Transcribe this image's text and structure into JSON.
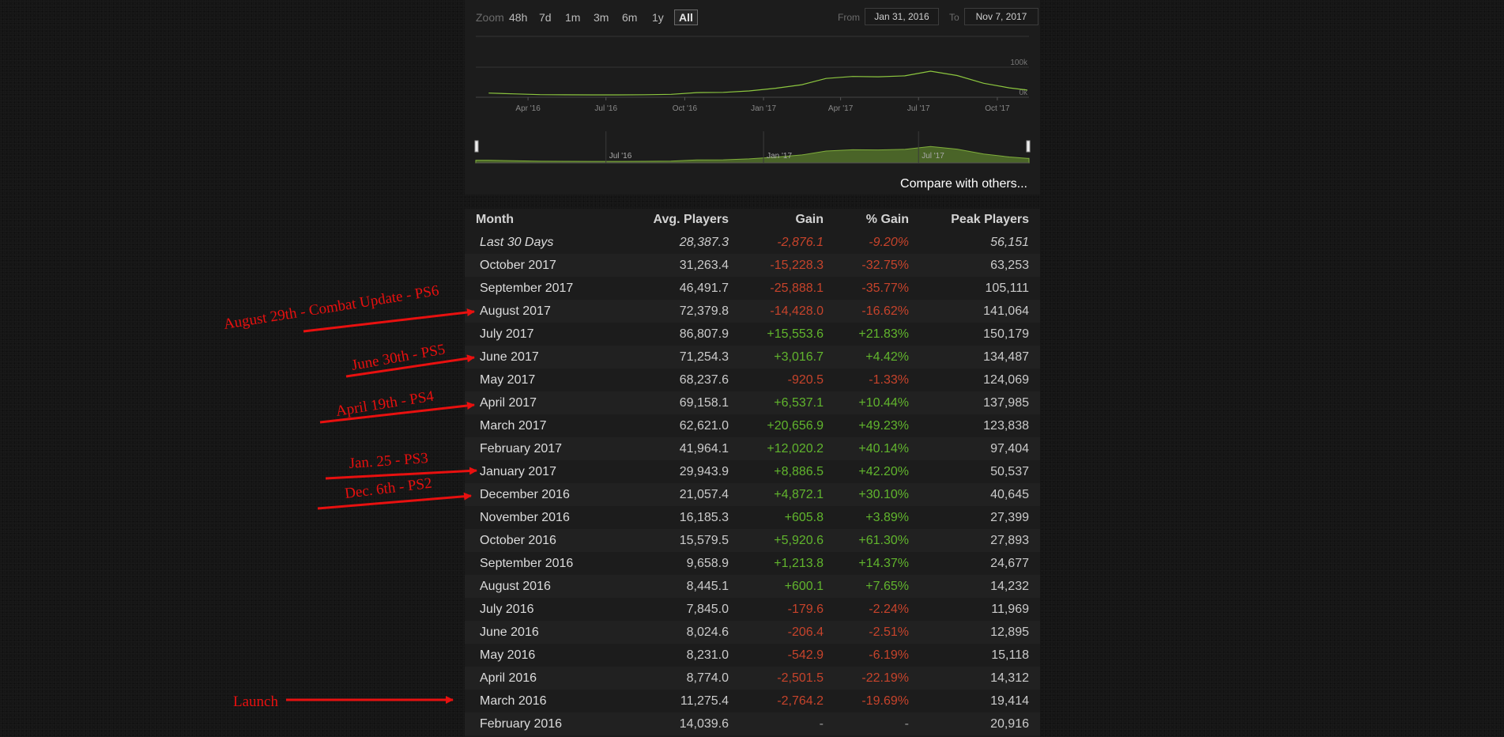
{
  "zoom": {
    "label": "Zoom",
    "options": [
      "48h",
      "7d",
      "1m",
      "3m",
      "6m",
      "1y",
      "All"
    ],
    "active": "All"
  },
  "range": {
    "from_label": "From",
    "from_value": "Jan 31, 2016",
    "to_label": "To",
    "to_value": "Nov 7, 2017"
  },
  "compare_link": "Compare with others...",
  "chart_data": {
    "type": "line",
    "x_ticks": [
      "Apr '16",
      "Jul '16",
      "Oct '16",
      "Jan '17",
      "Apr '17",
      "Jul '17",
      "Oct '17"
    ],
    "y_ticks": [
      "100k",
      "0k"
    ],
    "navigator_ticks": [
      "Jul '16",
      "Jan '17",
      "Jul '17"
    ],
    "x_range": [
      "2016-01-31",
      "2017-11-07"
    ],
    "ylim": [
      0,
      150000
    ],
    "series": [
      {
        "x": [
          "2016-02-15",
          "2016-03-15",
          "2016-04-15",
          "2016-05-15",
          "2016-06-15",
          "2016-07-15",
          "2016-08-15",
          "2016-09-15",
          "2016-10-15",
          "2016-11-15",
          "2016-12-15",
          "2017-01-15",
          "2017-02-15",
          "2017-03-15",
          "2017-04-15",
          "2017-05-15",
          "2017-06-15",
          "2017-07-15",
          "2017-08-15",
          "2017-09-15",
          "2017-10-15",
          "2017-11-05"
        ],
        "values": [
          14040,
          11275,
          8774,
          8231,
          8025,
          7845,
          8445,
          9659,
          15580,
          16185,
          21057,
          29944,
          41964,
          62621,
          69158,
          68238,
          71254,
          86808,
          72380,
          46492,
          31263,
          24000
        ]
      }
    ],
    "color": "#8cc63f"
  },
  "table": {
    "headers": [
      "Month",
      "Avg. Players",
      "Gain",
      "% Gain",
      "Peak Players"
    ],
    "rows": [
      {
        "month": "Last 30 Days",
        "avg": "28,387.3",
        "gain": "-2,876.1",
        "pct": "-9.20%",
        "peak": "56,151",
        "trend": "neg"
      },
      {
        "month": "October 2017",
        "avg": "31,263.4",
        "gain": "-15,228.3",
        "pct": "-32.75%",
        "peak": "63,253",
        "trend": "neg"
      },
      {
        "month": "September 2017",
        "avg": "46,491.7",
        "gain": "-25,888.1",
        "pct": "-35.77%",
        "peak": "105,111",
        "trend": "neg"
      },
      {
        "month": "August 2017",
        "avg": "72,379.8",
        "gain": "-14,428.0",
        "pct": "-16.62%",
        "peak": "141,064",
        "trend": "neg"
      },
      {
        "month": "July 2017",
        "avg": "86,807.9",
        "gain": "+15,553.6",
        "pct": "+21.83%",
        "peak": "150,179",
        "trend": "pos"
      },
      {
        "month": "June 2017",
        "avg": "71,254.3",
        "gain": "+3,016.7",
        "pct": "+4.42%",
        "peak": "134,487",
        "trend": "pos"
      },
      {
        "month": "May 2017",
        "avg": "68,237.6",
        "gain": "-920.5",
        "pct": "-1.33%",
        "peak": "124,069",
        "trend": "neg"
      },
      {
        "month": "April 2017",
        "avg": "69,158.1",
        "gain": "+6,537.1",
        "pct": "+10.44%",
        "peak": "137,985",
        "trend": "pos"
      },
      {
        "month": "March 2017",
        "avg": "62,621.0",
        "gain": "+20,656.9",
        "pct": "+49.23%",
        "peak": "123,838",
        "trend": "pos"
      },
      {
        "month": "February 2017",
        "avg": "41,964.1",
        "gain": "+12,020.2",
        "pct": "+40.14%",
        "peak": "97,404",
        "trend": "pos"
      },
      {
        "month": "January 2017",
        "avg": "29,943.9",
        "gain": "+8,886.5",
        "pct": "+42.20%",
        "peak": "50,537",
        "trend": "pos"
      },
      {
        "month": "December 2016",
        "avg": "21,057.4",
        "gain": "+4,872.1",
        "pct": "+30.10%",
        "peak": "40,645",
        "trend": "pos"
      },
      {
        "month": "November 2016",
        "avg": "16,185.3",
        "gain": "+605.8",
        "pct": "+3.89%",
        "peak": "27,399",
        "trend": "pos"
      },
      {
        "month": "October 2016",
        "avg": "15,579.5",
        "gain": "+5,920.6",
        "pct": "+61.30%",
        "peak": "27,893",
        "trend": "pos"
      },
      {
        "month": "September 2016",
        "avg": "9,658.9",
        "gain": "+1,213.8",
        "pct": "+14.37%",
        "peak": "24,677",
        "trend": "pos"
      },
      {
        "month": "August 2016",
        "avg": "8,445.1",
        "gain": "+600.1",
        "pct": "+7.65%",
        "peak": "14,232",
        "trend": "pos"
      },
      {
        "month": "July 2016",
        "avg": "7,845.0",
        "gain": "-179.6",
        "pct": "-2.24%",
        "peak": "11,969",
        "trend": "neg"
      },
      {
        "month": "June 2016",
        "avg": "8,024.6",
        "gain": "-206.4",
        "pct": "-2.51%",
        "peak": "12,895",
        "trend": "neg"
      },
      {
        "month": "May 2016",
        "avg": "8,231.0",
        "gain": "-542.9",
        "pct": "-6.19%",
        "peak": "15,118",
        "trend": "neg"
      },
      {
        "month": "April 2016",
        "avg": "8,774.0",
        "gain": "-2,501.5",
        "pct": "-22.19%",
        "peak": "14,312",
        "trend": "neg"
      },
      {
        "month": "March 2016",
        "avg": "11,275.4",
        "gain": "-2,764.2",
        "pct": "-19.69%",
        "peak": "19,414",
        "trend": "neg"
      },
      {
        "month": "February 2016",
        "avg": "14,039.6",
        "gain": "-",
        "pct": "-",
        "peak": "20,916",
        "trend": "neutral"
      }
    ]
  },
  "annotations": [
    {
      "text": "August 29th - Combat Update - PS6",
      "row": 3
    },
    {
      "text": "June 30th - PS5",
      "row": 5
    },
    {
      "text": "April 19th - PS4",
      "row": 7
    },
    {
      "text": "Jan. 25 - PS3",
      "row": 10
    },
    {
      "text": "Dec. 6th - PS2",
      "row": 11
    },
    {
      "text": "Launch",
      "row": 20
    }
  ],
  "annotation_color": "#e8100f"
}
